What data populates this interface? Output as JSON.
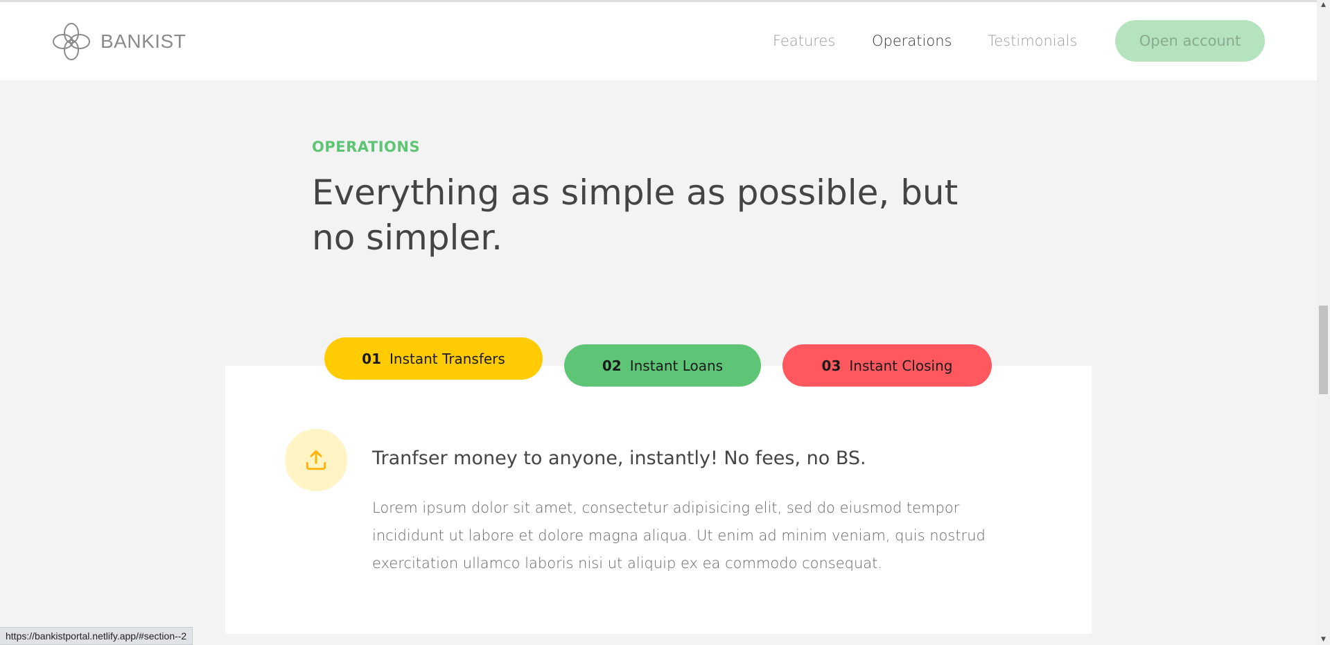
{
  "brand": {
    "name": "BANKIST"
  },
  "nav": {
    "links": [
      "Features",
      "Operations",
      "Testimonials"
    ],
    "cta": "Open account"
  },
  "section": {
    "label": "OPERATIONS",
    "headline": "Everything as simple as possible, but no simpler."
  },
  "tabs": [
    {
      "num": "01",
      "label": "Instant Transfers",
      "color": "#ffcb03"
    },
    {
      "num": "02",
      "label": "Instant Loans",
      "color": "#5ec576"
    },
    {
      "num": "03",
      "label": "Instant Closing",
      "color": "#ff585f"
    }
  ],
  "content": {
    "icon": "upload-icon",
    "title": "Tranfser money to anyone, instantly! No fees, no BS.",
    "body": "Lorem ipsum dolor sit amet, consectetur adipisicing elit, sed do eiusmod tempor incididunt ut labore et dolore magna aliqua. Ut enim ad minim veniam, quis nostrud exercitation ullamco laboris nisi ut aliquip ex ea commodo consequat."
  },
  "status_url": "https://bankistportal.netlify.app/#section--2",
  "colors": {
    "accent": "#5ec576",
    "tab1": "#ffcb03",
    "tab2": "#5ec576",
    "tab3": "#ff585f",
    "cta_bg": "#b5e3bd"
  }
}
